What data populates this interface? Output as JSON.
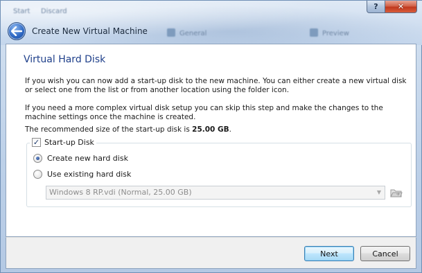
{
  "window": {
    "title": "Create New Virtual Machine",
    "help_glyph": "?",
    "close_glyph": "✕",
    "background_fragments": [
      "Start",
      "Discard",
      "General",
      "Preview"
    ]
  },
  "page": {
    "title": "Virtual Hard Disk",
    "paragraph1": "If you wish you can now add a start-up disk to the new machine. You can either create a new virtual disk or select one from the list or from another location using the folder icon.",
    "paragraph2": "If you need a more complex virtual disk setup you can skip this step and make the changes to the machine settings once the machine is created.",
    "recommended_prefix": "The recommended size of the start-up disk is ",
    "recommended_size": "25.00 GB",
    "recommended_suffix": "."
  },
  "startup_disk": {
    "label": "Start-up Disk",
    "checked": true,
    "check_glyph": "✓",
    "options": [
      {
        "label": "Create new hard disk",
        "selected": true
      },
      {
        "label": "Use existing hard disk",
        "selected": false
      }
    ],
    "existing_disk_value": "Windows 8 RP.vdi (Normal, 25.00 GB)",
    "existing_disk_enabled": false
  },
  "footer": {
    "next_label": "Next",
    "cancel_label": "Cancel"
  },
  "icons": {
    "back": "back-arrow-icon",
    "folder": "folder-icon",
    "dropdown": "chevron-down-icon"
  },
  "colors": {
    "title_blue": "#1e3f8a",
    "accent_button_border": "#3c7fb1",
    "close_red": "#c0391e"
  }
}
